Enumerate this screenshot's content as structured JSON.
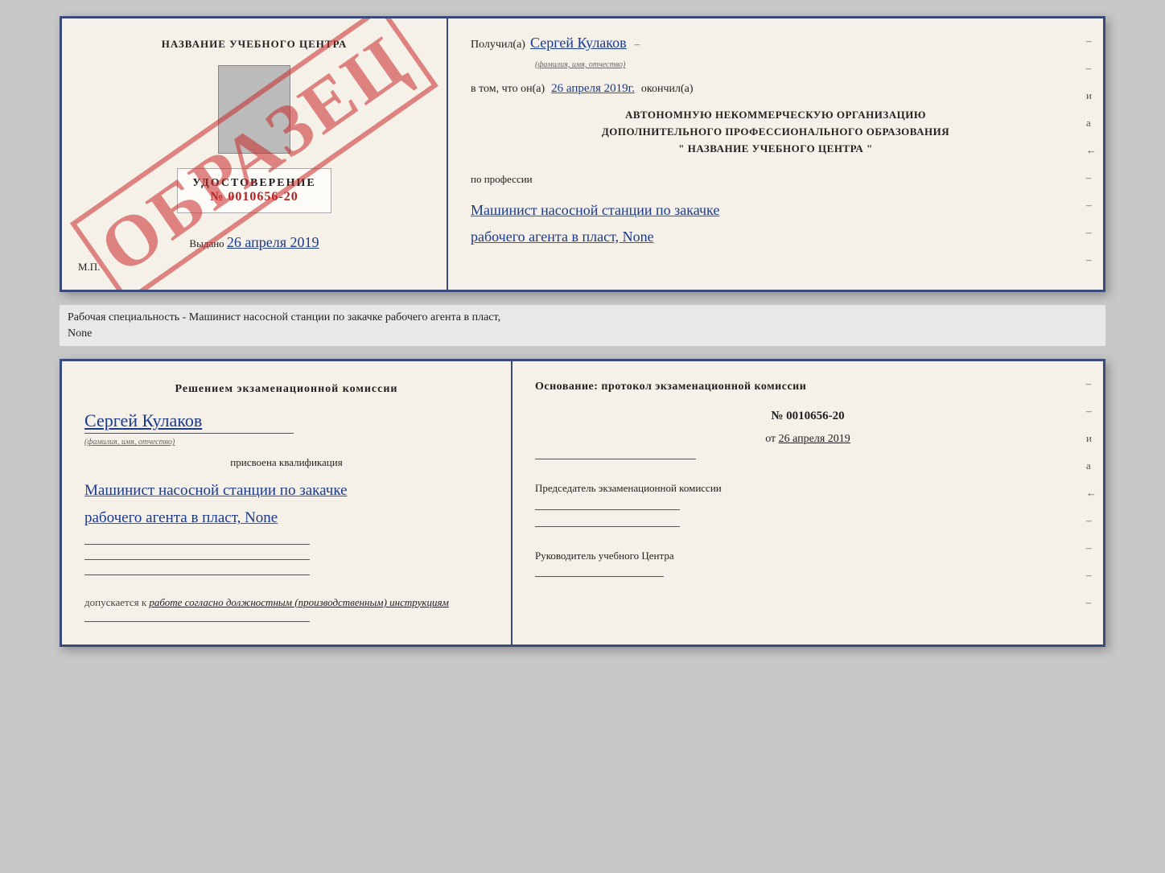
{
  "top_doc": {
    "left": {
      "school_name": "НАЗВАНИЕ УЧЕБНОГО ЦЕНТРА",
      "obrazec": "ОБРАЗЕЦ",
      "udostoverenie_title": "УДОСТОВЕРЕНИЕ",
      "udostoverenie_num": "№ 0010656-20",
      "vydano_label": "Выдано",
      "vydano_date": "26 апреля 2019",
      "mp": "М.П."
    },
    "right": {
      "poluchil_label": "Получил(а)",
      "poluchil_fio": "Сергей Кулаков",
      "fio_hint": "(фамилия, имя, отчество)",
      "vtom_label": "в том, что он(а)",
      "date_value": "26 апреля 2019г.",
      "okonchil_label": "окончил(а)",
      "org_line1": "АВТОНОМНУЮ НЕКОММЕРЧЕСКУЮ ОРГАНИЗАЦИЮ",
      "org_line2": "ДОПОЛНИТЕЛЬНОГО ПРОФЕССИОНАЛЬНОГО ОБРАЗОВАНИЯ",
      "org_name": "\" НАЗВАНИЕ УЧЕБНОГО ЦЕНТРА \"",
      "profession_label": "по профессии",
      "profession_line1": "Машинист насосной станции по закачке",
      "profession_line2": "рабочего агента в пласт, None"
    }
  },
  "separator": {
    "text": "Рабочая специальность - Машинист насосной станции по закачке рабочего агента в пласт,",
    "text2": "None"
  },
  "bottom_doc": {
    "left": {
      "komissia_text": "Решением экзаменационной комиссии",
      "fio": "Сергей Кулаков",
      "fio_hint": "(фамилия, имя, отчество)",
      "prisvoena_label": "присвоена квалификация",
      "kvalif_line1": "Машинист насосной станции по закачке",
      "kvalif_line2": "рабочего агента в пласт, None",
      "dopusk_label": "допускается к",
      "dopusk_value": "работе согласно должностным (производственным) инструкциям"
    },
    "right": {
      "osnov_label": "Основание: протокол экзаменационной комиссии",
      "protokol_num": "№ 0010656-20",
      "ot_label": "от",
      "protokol_date": "26 апреля 2019",
      "predsed_label": "Председатель экзаменационной комиссии",
      "ruk_label": "Руководитель учебного Центра"
    }
  }
}
